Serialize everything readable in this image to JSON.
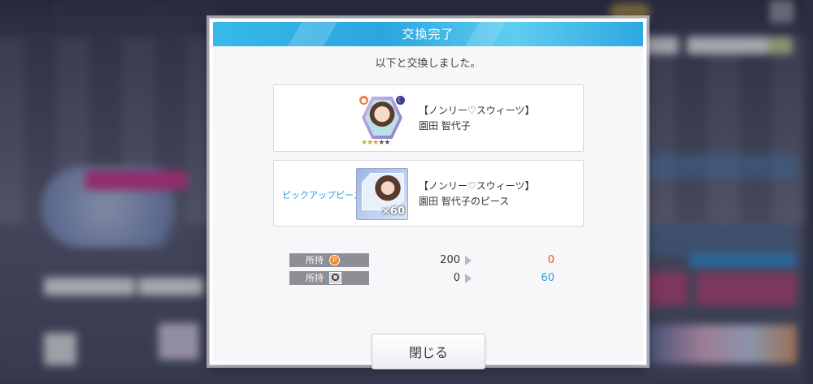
{
  "dialog": {
    "title": "交換完了",
    "message": "以下と交換しました。"
  },
  "items": [
    {
      "tag": "",
      "name": "【ノンリー♡スウィーツ】",
      "sub": "園田 智代子",
      "icon": "idol-card-icon",
      "rarity_stars": 3,
      "rarity_max": 5
    },
    {
      "tag": "ピックアップピース",
      "name": "【ノンリー♡スウィーツ】",
      "sub": "園田 智代子のピース",
      "icon": "piece-icon",
      "count": "×60"
    }
  ],
  "holdings": [
    {
      "label": "所持",
      "icon": "p-coin-icon",
      "before": "200",
      "after": "0",
      "after_color": "#e2513a"
    },
    {
      "label": "所持",
      "icon": "idol-face-icon",
      "before": "0",
      "after": "60",
      "after_color": "#2c9fd8"
    }
  ],
  "close_label": "閉じる",
  "colors": {
    "header": "#2aa6e0",
    "accent_blue": "#2c9fd8",
    "accent_red": "#e2513a"
  }
}
